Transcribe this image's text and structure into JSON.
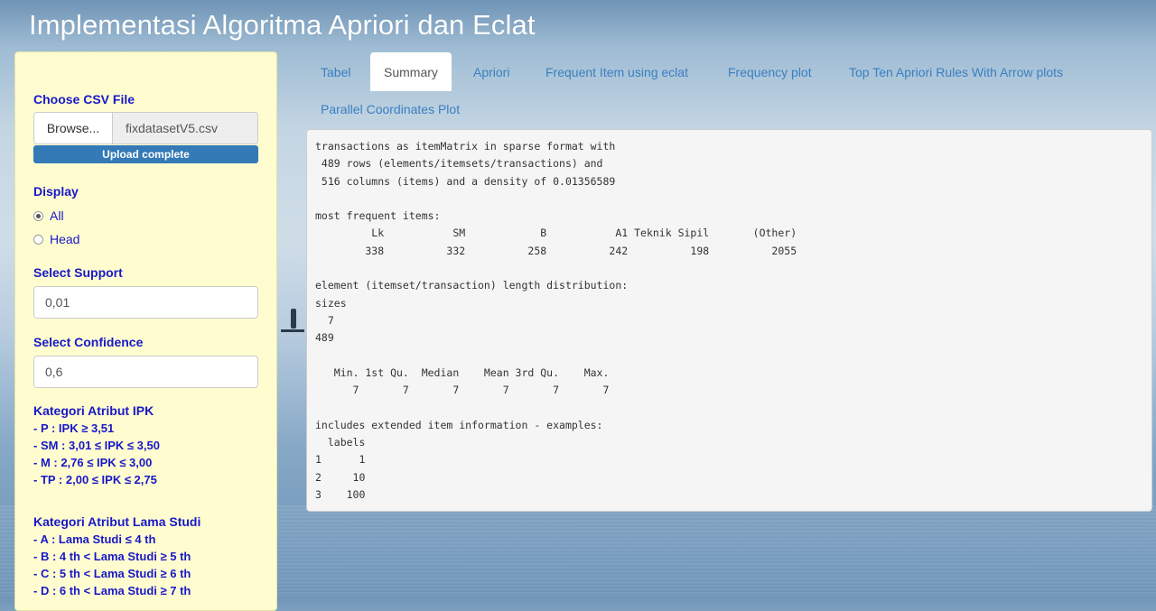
{
  "app": {
    "title": "Implementasi Algoritma Apriori dan Eclat"
  },
  "sidebar": {
    "csv_label": "Choose CSV File",
    "browse_label": "Browse...",
    "file_name": "fixdatasetV5.csv",
    "upload_status": "Upload complete",
    "upload_progress_percent": 100,
    "display_label": "Display",
    "display_options": [
      {
        "label": "All",
        "checked": true
      },
      {
        "label": "Head",
        "checked": false
      }
    ],
    "support_label": "Select Support",
    "support_value": "0,01",
    "confidence_label": "Select Confidence",
    "confidence_value": "0,6",
    "ipk": {
      "title": "Kategori Atribut IPK",
      "items": [
        "- P : IPK ≥ 3,51",
        "- SM : 3,01 ≤ IPK ≤ 3,50",
        "- M : 2,76 ≤ IPK ≤ 3,00",
        "- TP : 2,00 ≤ IPK ≤ 2,75"
      ]
    },
    "lama_studi": {
      "title": "Kategori Atribut Lama Studi",
      "items": [
        "- A : Lama Studi ≤ 4 th",
        "- B : 4 th < Lama Studi ≥ 5 th",
        "- C : 5 th < Lama Studi ≥ 6 th",
        "- D : 6 th < Lama Studi ≥ 7 th"
      ]
    }
  },
  "tabs": [
    {
      "label": "Tabel",
      "active": false
    },
    {
      "label": "Summary",
      "active": true
    },
    {
      "label": "Apriori",
      "active": false
    },
    {
      "label": "Frequent Item using eclat",
      "active": false
    },
    {
      "label": "Frequency plot",
      "active": false
    },
    {
      "label": "Top Ten Apriori Rules With Arrow plots",
      "active": false
    },
    {
      "label": "Parallel Coordinates Plot",
      "active": false
    }
  ],
  "summary_output": "transactions as itemMatrix in sparse format with\n 489 rows (elements/itemsets/transactions) and\n 516 columns (items) and a density of 0.01356589\n\nmost frequent items:\n         Lk           SM            B           A1 Teknik Sipil       (Other)\n        338          332          258          242          198          2055\n\nelement (itemset/transaction) length distribution:\nsizes\n  7\n489\n\n   Min. 1st Qu.  Median    Mean 3rd Qu.    Max.\n      7       7       7       7       7       7\n\nincludes extended item information - examples:\n  labels\n1      1\n2     10\n3    100"
}
